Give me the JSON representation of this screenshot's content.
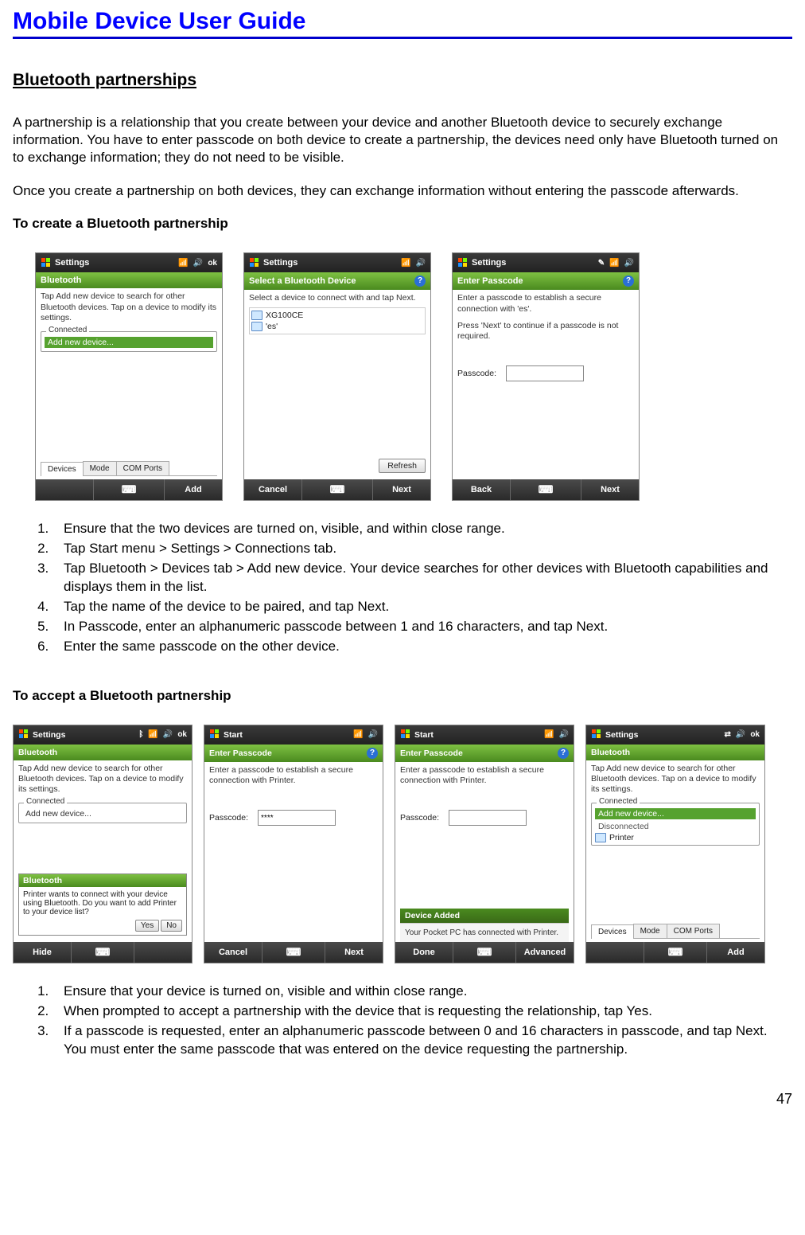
{
  "doc": {
    "title": "Mobile Device User Guide",
    "page_number": "47"
  },
  "section": {
    "title": "Bluetooth partnerships",
    "para1": "A partnership is a relationship that you create between your device and another Bluetooth device to securely exchange information. You have to enter passcode on both device to create a partnership, the devices need only have Bluetooth turned on to exchange information; they do not need to be visible.",
    "para2": "Once you create a partnership on both devices, they can exchange information without entering the passcode afterwards."
  },
  "create": {
    "heading": "To create a Bluetooth partnership",
    "steps": [
      "Ensure that the two devices are turned on, visible, and within close range.",
      "Tap Start menu > Settings > Connections tab.",
      "Tap Bluetooth > Devices tab > Add new device. Your device searches for other devices with Bluetooth capabilities and displays them in the list.",
      "Tap the name of the device to be paired, and tap Next.",
      "In Passcode, enter an alphanumeric passcode between 1 and 16 characters, and tap Next.",
      "Enter the same passcode on the other device."
    ]
  },
  "accept": {
    "heading": "To accept a Bluetooth partnership",
    "steps": [
      "Ensure that your device is turned on, visible and within close range.",
      "When prompted to accept a partnership with the device that is requesting the relationship, tap Yes.",
      "If a passcode is requested, enter an alphanumeric passcode between 0 and 16 characters in passcode, and tap Next. You must enter the same passcode that was entered on the device requesting the partnership."
    ]
  },
  "screens": {
    "s1": {
      "title": "Settings",
      "ok": "ok",
      "header": "Bluetooth",
      "instr": "Tap Add new device to search for other Bluetooth devices. Tap on a device to modify its settings.",
      "group": "Connected",
      "sel": "Add new device...",
      "tabs": [
        "Devices",
        "Mode",
        "COM Ports"
      ],
      "bb_right": "Add"
    },
    "s2": {
      "title": "Settings",
      "header": "Select a Bluetooth Device",
      "instr": "Select a device to connect with and tap Next.",
      "items": [
        "XG100CE",
        "'es'"
      ],
      "refresh": "Refresh",
      "bb_left": "Cancel",
      "bb_right": "Next"
    },
    "s3": {
      "title": "Settings",
      "header": "Enter Passcode",
      "instr1": "Enter a passcode to establish a secure connection with 'es'.",
      "instr2": "Press 'Next' to continue if a passcode is not required.",
      "pass_label": "Passcode:",
      "bb_left": "Back",
      "bb_right": "Next"
    },
    "a1": {
      "title": "Settings",
      "ok": "ok",
      "header": "Bluetooth",
      "instr": "Tap Add new device to search for other Bluetooth devices. Tap on a device to modify its settings.",
      "group": "Connected",
      "item": "Add new device...",
      "popup_title": "Bluetooth",
      "popup_body": "Printer wants to connect with your device using Bluetooth. Do you want to add Printer to your device list?",
      "yes": "Yes",
      "no": "No",
      "bb_left": "Hide"
    },
    "a2": {
      "title": "Start",
      "header": "Enter Passcode",
      "instr": "Enter a passcode to establish a secure connection with Printer.",
      "pass_label": "Passcode:",
      "pass_value": "****",
      "bb_left": "Cancel",
      "bb_right": "Next"
    },
    "a3": {
      "title": "Start",
      "header": "Enter Passcode",
      "instr": "Enter a passcode to establish a secure connection with Printer.",
      "pass_label": "Passcode:",
      "added_title": "Device Added",
      "added_body": "Your Pocket PC has connected with Printer.",
      "bb_left": "Done",
      "bb_right": "Advanced"
    },
    "a4": {
      "title": "Settings",
      "ok": "ok",
      "header": "Bluetooth",
      "instr": "Tap Add new device to search for other Bluetooth devices. Tap on a device to modify its settings.",
      "group1": "Connected",
      "sel": "Add new device...",
      "group2": "Disconnected",
      "item2": "Printer",
      "tabs": [
        "Devices",
        "Mode",
        "COM Ports"
      ],
      "bb_right": "Add"
    }
  }
}
